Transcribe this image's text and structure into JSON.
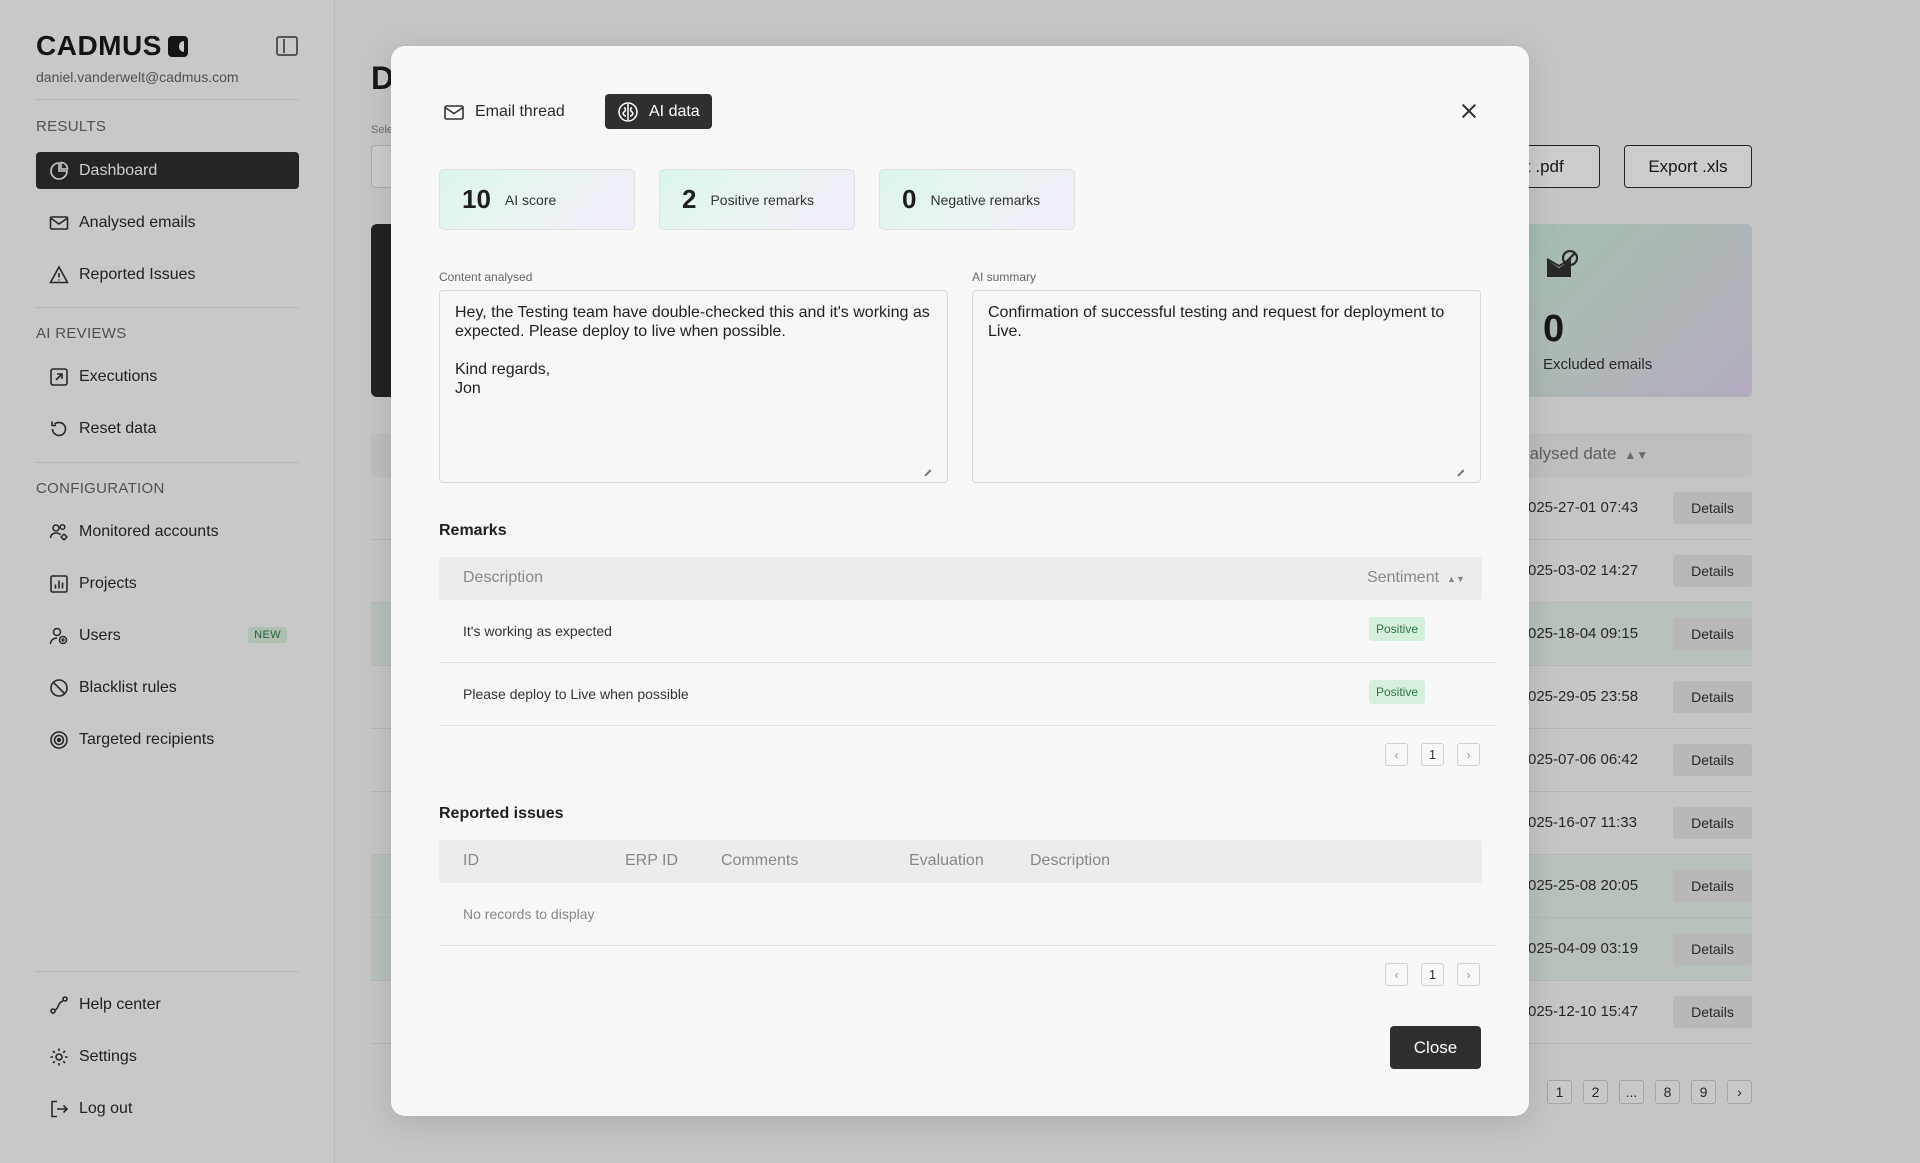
{
  "sidebar": {
    "brand": "CADMUS",
    "user_email": "daniel.vanderwelt@cadmus.com",
    "sections": {
      "results": "RESULTS",
      "ai_reviews": "AI REVIEWS",
      "configuration": "CONFIGURATION"
    },
    "items": {
      "dashboard": "Dashboard",
      "analysed_emails": "Analysed emails",
      "reported_issues": "Reported Issues",
      "executions": "Executions",
      "reset_data": "Reset data",
      "monitored_accounts": "Monitored accounts",
      "projects": "Projects",
      "users": "Users",
      "blacklist_rules": "Blacklist rules",
      "targeted_recipients": "Targeted recipients",
      "help_center": "Help center",
      "settings": "Settings",
      "log_out": "Log out"
    },
    "users_badge": "NEW"
  },
  "background": {
    "title_initial": "D",
    "select_label": "Sele",
    "export_pdf": "rt .pdf",
    "export_xls": "Export .xls",
    "excluded_count": "0",
    "excluded_label": "Excluded emails",
    "analysed_date_header": "nalysed date",
    "details_label": "Details",
    "rows": [
      {
        "date": "025-27-01 07:43",
        "highlighted": false
      },
      {
        "date": "025-03-02 14:27",
        "highlighted": false
      },
      {
        "date": "025-18-04 09:15",
        "highlighted": true
      },
      {
        "date": "025-29-05 23:58",
        "highlighted": false
      },
      {
        "date": "025-07-06 06:42",
        "highlighted": false
      },
      {
        "date": "025-16-07 11:33",
        "highlighted": false
      },
      {
        "date": "025-25-08 20:05",
        "highlighted": true
      },
      {
        "date": "025-04-09 03:19",
        "highlighted": true
      },
      {
        "date": "025-12-10 15:47",
        "highlighted": false
      }
    ],
    "pagination": [
      "1",
      "2",
      "...",
      "8",
      "9"
    ]
  },
  "modal": {
    "tabs": {
      "email_thread": "Email thread",
      "ai_data": "AI data"
    },
    "scores": [
      {
        "value": "10",
        "label": "AI score"
      },
      {
        "value": "2",
        "label": "Positive remarks"
      },
      {
        "value": "0",
        "label": "Negative remarks"
      }
    ],
    "content_label": "Content analysed",
    "content_text": "Hey, the Testing team have double-checked this and it's working as expected. Please deploy to live when possible.\n\nKind regards,\nJon",
    "summary_label": "AI summary",
    "summary_text": "Confirmation of successful testing and request for deployment to Live.",
    "remarks": {
      "title": "Remarks",
      "col_description": "Description",
      "col_sentiment": "Sentiment",
      "rows": [
        {
          "description": "It's working as expected",
          "sentiment": "Positive"
        },
        {
          "description": "Please deploy to Live when possible",
          "sentiment": "Positive"
        }
      ],
      "page": "1"
    },
    "issues": {
      "title": "Reported issues",
      "columns": [
        "ID",
        "ERP ID",
        "Comments",
        "Evaluation",
        "Description"
      ],
      "empty": "No records to display",
      "page": "1"
    },
    "close_label": "Close"
  }
}
